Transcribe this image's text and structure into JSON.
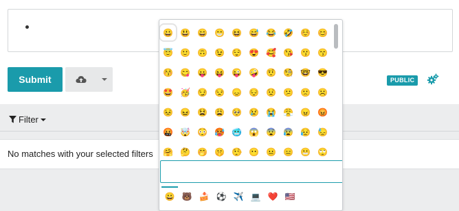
{
  "composer": {
    "editor_text": "",
    "submit_label": "Submit",
    "visibility_badge": "PUBLIC"
  },
  "filter": {
    "label": "Filter"
  },
  "results": {
    "empty_message": "No matches with your selected filters"
  },
  "emoji_picker": {
    "search_value": "",
    "emoji_rows": [
      [
        "😀",
        "😃",
        "😄",
        "😁",
        "😆",
        "😅",
        "😂",
        "🤣",
        "☺️",
        "😊"
      ],
      [
        "😇",
        "🙂",
        "🙃",
        "😉",
        "😌",
        "😍",
        "🥰",
        "😘",
        "😗",
        "😙"
      ],
      [
        "😚",
        "😋",
        "😛",
        "😝",
        "😜",
        "🤪",
        "🤨",
        "🧐",
        "🤓",
        "😎"
      ],
      [
        "🤩",
        "🥳",
        "😏",
        "😒",
        "😞",
        "😔",
        "😟",
        "😕",
        "🙁",
        "☹️"
      ],
      [
        "😣",
        "😖",
        "😫",
        "😩",
        "🥺",
        "😢",
        "😭",
        "😤",
        "😠",
        "😡"
      ],
      [
        "🤬",
        "🤯",
        "😳",
        "🥵",
        "🥶",
        "😱",
        "😨",
        "😰",
        "😥",
        "😓"
      ],
      [
        "🤗",
        "🤔",
        "🤭",
        "🤫",
        "🤥",
        "😶",
        "😐",
        "😑",
        "😬",
        "🙄"
      ]
    ],
    "categories": [
      "smileys",
      "animals",
      "food",
      "activity",
      "travel",
      "objects",
      "symbols",
      "flags"
    ],
    "category_glyphs": [
      "😀",
      "🐻",
      "🍰",
      "⚽",
      "✈️",
      "💻",
      "❤️",
      "🇺🇸"
    ],
    "selected_category": "smileys",
    "colors": {
      "accent": "#1a9bab",
      "face": "#f6c33f",
      "angry_red": "#d83a3a"
    }
  }
}
